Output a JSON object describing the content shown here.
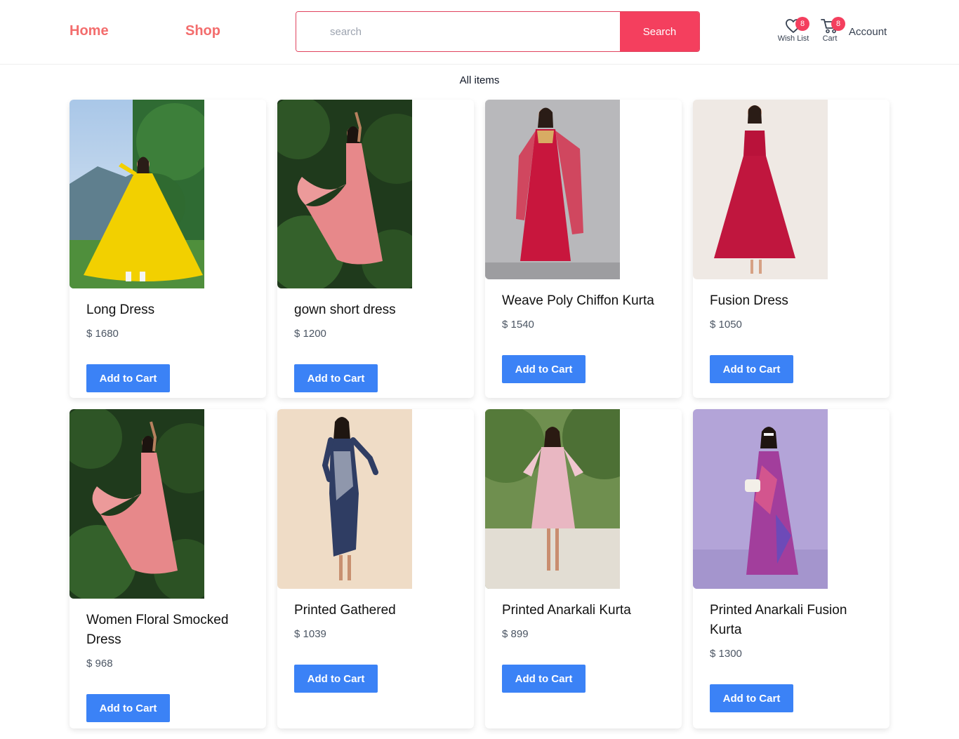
{
  "nav": {
    "home": "Home",
    "shop": "Shop"
  },
  "search": {
    "placeholder": "search",
    "button": "Search"
  },
  "header_icons": {
    "wishlist": {
      "label": "Wish List",
      "count": "8"
    },
    "cart": {
      "label": "Cart",
      "count": "8"
    },
    "account": "Account"
  },
  "section_title": "All items",
  "products": [
    {
      "title": "Long Dress",
      "price": "$ 1680",
      "button": "Add to Cart"
    },
    {
      "title": "gown short dress",
      "price": "$ 1200",
      "button": "Add to Cart"
    },
    {
      "title": "Weave Poly Chiffon Kurta",
      "price": "$ 1540",
      "button": "Add to Cart"
    },
    {
      "title": "Fusion Dress",
      "price": "$ 1050",
      "button": "Add to Cart"
    },
    {
      "title": "Women Floral Smocked Dress",
      "price": "$ 968",
      "button": "Add to Cart"
    },
    {
      "title": "Printed Gathered",
      "price": "$ 1039",
      "button": "Add to Cart"
    },
    {
      "title": "Printed Anarkali Kurta",
      "price": "$ 899",
      "button": "Add to Cart"
    },
    {
      "title": "Printed Anarkali Fusion Kurta",
      "price": "$ 1300",
      "button": "Add to Cart"
    }
  ],
  "colors": {
    "accent_pink": "#f43f5e",
    "nav_coral": "#f36d6d",
    "button_blue": "#3b82f6"
  }
}
